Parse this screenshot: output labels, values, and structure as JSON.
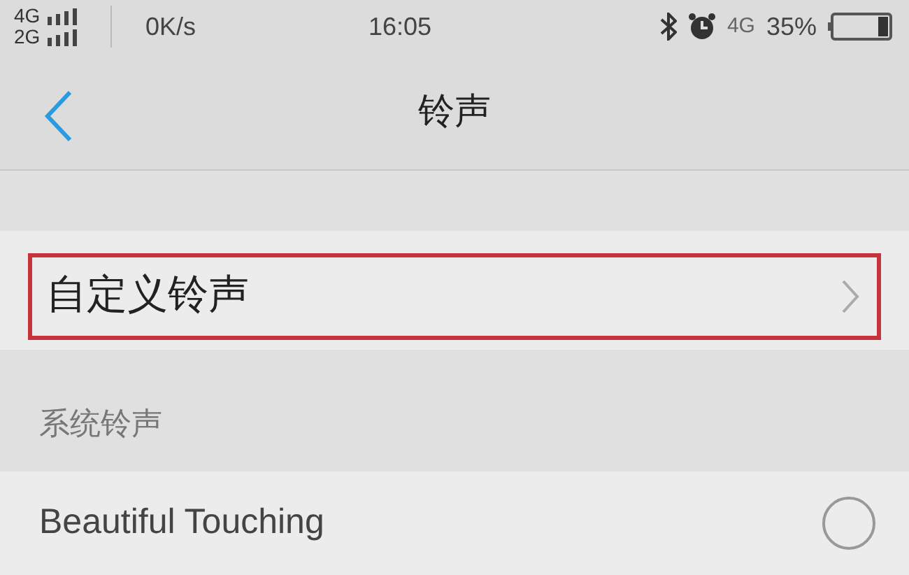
{
  "status_bar": {
    "sim_1": "4G",
    "sim_2": "2G",
    "speed": "0K/s",
    "time": "16:05",
    "network": "4G",
    "battery_text": "35%"
  },
  "header": {
    "title": "铃声"
  },
  "custom_row": {
    "label": "自定义铃声",
    "highlighted": true
  },
  "section": {
    "title": "系统铃声"
  },
  "ringtones": [
    {
      "name": "Beautiful Touching",
      "selected": false
    }
  ]
}
